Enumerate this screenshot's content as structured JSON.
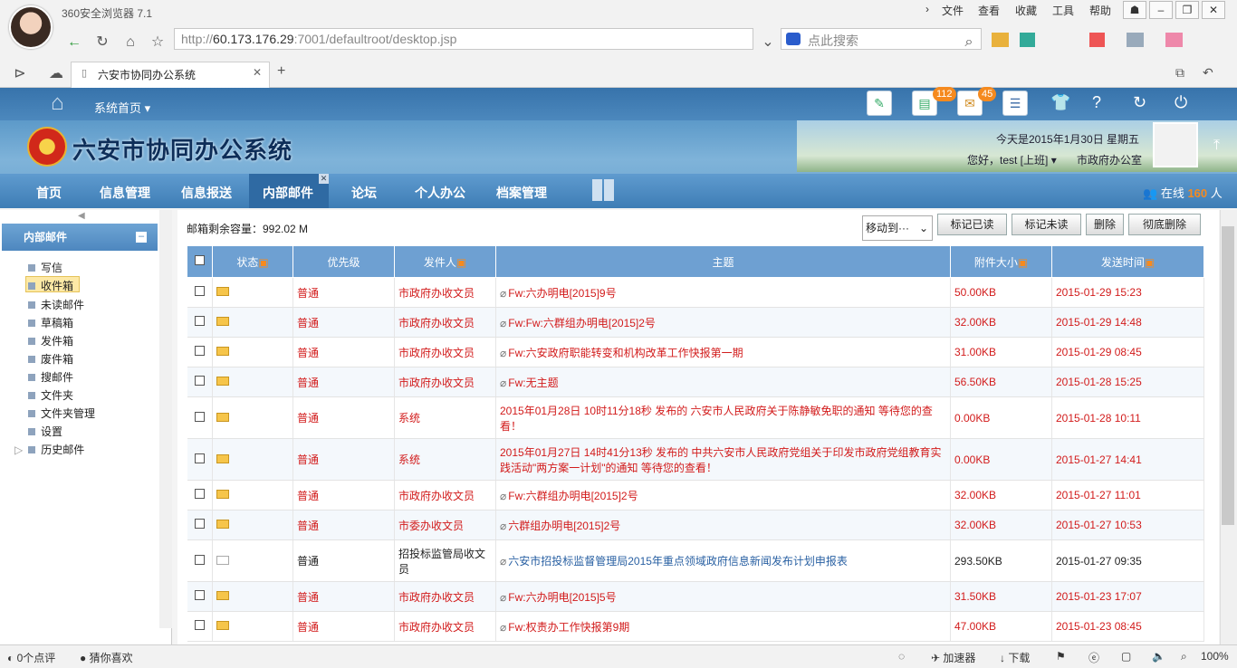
{
  "browser": {
    "title": "360安全浏览器 7.1",
    "menu": [
      "文件",
      "查看",
      "收藏",
      "工具",
      "帮助"
    ],
    "url_grey": "http://",
    "url_host": "60.173.176.29",
    "url_rest": ":7001/defaultroot/desktop.jsp",
    "search_placeholder": "点此搜索",
    "tab_title": "六安市协同办公系统"
  },
  "app": {
    "home_label": "系统首页",
    "system_name": "六安市协同办公系统",
    "date_text": "今天是2015年1月30日 星期五",
    "user_text": "您好，test [上班]",
    "dept": "市政府办公室",
    "badge1": "112",
    "badge2": "45",
    "online_prefix": "在线",
    "online_count": "160",
    "online_suffix": "人"
  },
  "nav": [
    "首页",
    "信息管理",
    "信息报送",
    "内部邮件",
    "论坛",
    "个人办公",
    "档案管理"
  ],
  "sidebar": {
    "title": "内部邮件",
    "items": [
      "写信",
      "收件箱",
      "未读邮件",
      "草稿箱",
      "发件箱",
      "废件箱",
      "搜邮件",
      "文件夹",
      "文件夹管理",
      "设置",
      "历史邮件"
    ]
  },
  "mail": {
    "capacity": "邮箱剩余容量：992.02 M",
    "move_label": "移动到···",
    "buttons": [
      "标记已读",
      "标记未读",
      "删除",
      "彻底删除"
    ],
    "headers": [
      "状态",
      "优先级",
      "发件人",
      "主题",
      "附件大小",
      "发送时间"
    ],
    "rows": [
      {
        "priority": "普通",
        "sender": "市政府办收文员",
        "subject": "Fw:六办明电[2015]9号",
        "size": "50.00KB",
        "time": "2015-01-29 15:23",
        "clip": true,
        "red": true
      },
      {
        "priority": "普通",
        "sender": "市政府办收文员",
        "subject": "Fw:Fw:六群组办明电[2015]2号",
        "size": "32.00KB",
        "time": "2015-01-29 14:48",
        "clip": true,
        "red": true
      },
      {
        "priority": "普通",
        "sender": "市政府办收文员",
        "subject": "Fw:六安政府职能转变和机构改革工作快报第一期",
        "size": "31.00KB",
        "time": "2015-01-29 08:45",
        "clip": true,
        "red": true
      },
      {
        "priority": "普通",
        "sender": "市政府办收文员",
        "subject": "Fw:无主题",
        "size": "56.50KB",
        "time": "2015-01-28 15:25",
        "clip": true,
        "red": true
      },
      {
        "priority": "普通",
        "sender": "系统",
        "subject": "2015年01月28日 10时11分18秒 发布的 六安市人民政府关于陈静敏免职的通知 等待您的查看！",
        "size": "0.00KB",
        "time": "2015-01-28 10:11",
        "clip": false,
        "red": true
      },
      {
        "priority": "普通",
        "sender": "系统",
        "subject": "2015年01月27日 14时41分13秒 发布的 中共六安市人民政府党组关于印发市政府党组教育实践活动\"两方案一计划\"的通知 等待您的查看！",
        "size": "0.00KB",
        "time": "2015-01-27 14:41",
        "clip": false,
        "red": true
      },
      {
        "priority": "普通",
        "sender": "市政府办收文员",
        "subject": "Fw:六群组办明电[2015]2号",
        "size": "32.00KB",
        "time": "2015-01-27 11:01",
        "clip": true,
        "red": true
      },
      {
        "priority": "普通",
        "sender": "市委办收文员",
        "subject": "六群组办明电[2015]2号",
        "size": "32.00KB",
        "time": "2015-01-27 10:53",
        "clip": true,
        "red": true
      },
      {
        "priority": "普通",
        "sender": "招投标监管局收文员",
        "subject": "六安市招投标监督管理局2015年重点领域政府信息新闻发布计划申报表",
        "size": "293.50KB",
        "time": "2015-01-27 09:35",
        "clip": true,
        "red": false
      },
      {
        "priority": "普通",
        "sender": "市政府办收文员",
        "subject": "Fw:六办明电[2015]5号",
        "size": "31.50KB",
        "time": "2015-01-23 17:07",
        "clip": true,
        "red": true
      },
      {
        "priority": "普通",
        "sender": "市政府办收文员",
        "subject": "Fw:权责办工作快报第9期",
        "size": "47.00KB",
        "time": "2015-01-23 08:45",
        "clip": true,
        "red": true
      }
    ]
  },
  "status": {
    "left1": "0个点评",
    "left2": "猜你喜欢",
    "accel": "加速器",
    "download": "下载",
    "zoom": "100%"
  }
}
